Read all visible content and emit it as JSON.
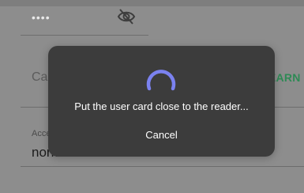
{
  "form": {
    "password_value": "••••",
    "visibility_icon": "eye-off-icon",
    "card_number_label": "Card number",
    "learn_label": "LEARN",
    "learn_icon": "card-reader-icon",
    "access_type_label": "Access type",
    "access_type_value": "normal"
  },
  "dialog": {
    "message": "Put the user card close to the reader...",
    "cancel_label": "Cancel",
    "spinner_icon": "loading-spinner-icon"
  },
  "colors": {
    "accent_green": "#2e8a55",
    "spinner": "#7b82f0",
    "dialog_bg": "#3c3c3c"
  }
}
